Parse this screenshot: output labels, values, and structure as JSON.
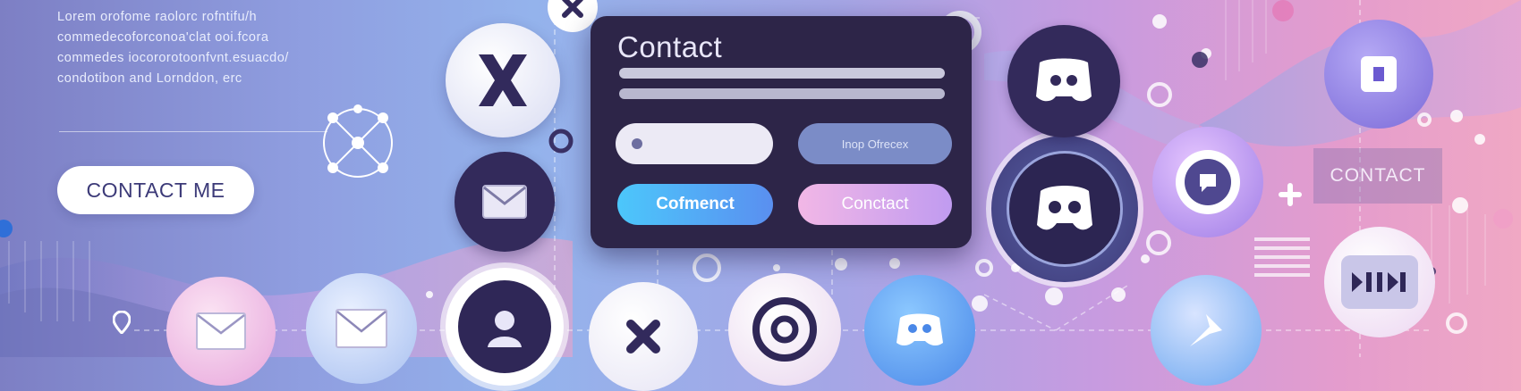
{
  "intro": {
    "lines": [
      "Lorem orofome raolorc rofntifu/h",
      "commedecoforconoa'clat ooi.fcora",
      "commedes iocororotoonfvnt.esuacdo/",
      "condotibon and Lornddon, erc"
    ]
  },
  "cta": {
    "label": "CONTACT ME"
  },
  "panel": {
    "title": "Contact",
    "field_left": "",
    "field_right": "Inop Ofrecex",
    "button_primary": "Cofmenct",
    "button_secondary": "Conctact"
  },
  "side": {
    "contact_label": "CONTACT"
  },
  "icons": [
    "x-icon",
    "envelope-icon",
    "network-icon",
    "discord-icon",
    "chat-icon",
    "person-icon",
    "target-icon",
    "pin-icon",
    "tool-icon",
    "link-icon"
  ],
  "colors": {
    "panel": "#2d2548",
    "accent_blue": "#4cc7fb",
    "accent_pink": "#f2b7e6",
    "icon_dark": "#2e2653"
  }
}
